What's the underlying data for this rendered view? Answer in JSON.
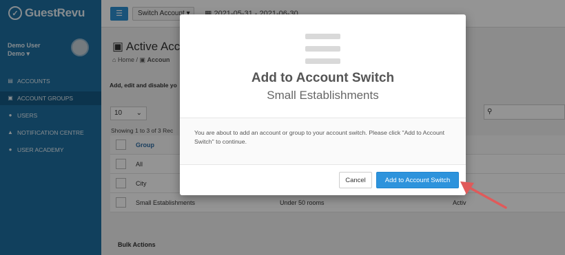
{
  "app": {
    "logo": "GuestRevu",
    "logo_icon": "check-circle-icon"
  },
  "sidebar": {
    "user_name": "Demo User",
    "user_org": "Demo ▾",
    "items": [
      {
        "label": "ACCOUNTS",
        "icon": "list-icon"
      },
      {
        "label": "ACCOUNT GROUPS",
        "icon": "group-icon"
      },
      {
        "label": "USERS",
        "icon": "user-icon"
      },
      {
        "label": "NOTIFICATION CENTRE",
        "icon": "bell-icon"
      },
      {
        "label": "USER ACADEMY",
        "icon": "info-icon"
      }
    ]
  },
  "topbar": {
    "menu_icon": "hamburger-icon",
    "switch_label": "Switch Account ▾",
    "date_range": "2021-05-31 - 2021-06-30"
  },
  "page": {
    "title": "Active Acc",
    "breadcrumb_home": "Home",
    "breadcrumb_current": "Accoun",
    "subtitle": "Add, edit and disable yo",
    "page_size": "10",
    "showing": "Showing 1 to 3 of 3 Rec",
    "table": {
      "headers": [
        "Group",
        "",
        "us"
      ],
      "rows": [
        [
          "All",
          "",
          "e"
        ],
        [
          "City",
          "",
          "e"
        ],
        [
          "Small Establishments",
          "Under 50 rooms",
          "Activ"
        ]
      ]
    },
    "bulk_actions": "Bulk Actions"
  },
  "modal": {
    "title": "Add to Account Switch",
    "subtitle": "Small Establishments",
    "message": "You are about to add an account or group to your account switch. Please click \"Add to Account Switch\" to continue.",
    "cancel_label": "Cancel",
    "confirm_label": "Add to Account Switch"
  },
  "colors": {
    "primary": "#2d93dc",
    "sidebar": "#1e6fa1",
    "annotation_arrow": "#e05a5a"
  }
}
